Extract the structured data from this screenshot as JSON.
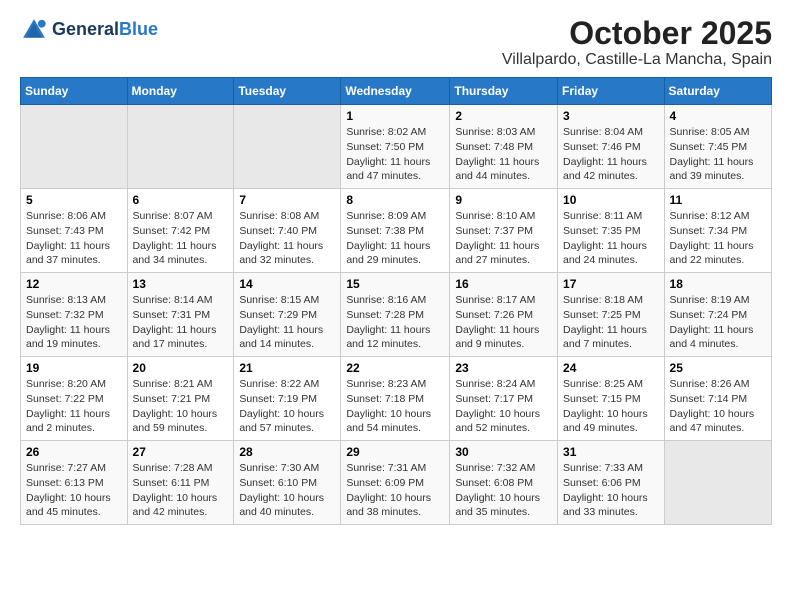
{
  "header": {
    "logo_general": "General",
    "logo_blue": "Blue",
    "month": "October 2025",
    "location": "Villalpardo, Castille-La Mancha, Spain"
  },
  "weekdays": [
    "Sunday",
    "Monday",
    "Tuesday",
    "Wednesday",
    "Thursday",
    "Friday",
    "Saturday"
  ],
  "weeks": [
    [
      {
        "day": "",
        "empty": true
      },
      {
        "day": "",
        "empty": true
      },
      {
        "day": "",
        "empty": true
      },
      {
        "day": "1",
        "sunrise": "8:02 AM",
        "sunset": "7:50 PM",
        "daylight": "11 hours and 47 minutes."
      },
      {
        "day": "2",
        "sunrise": "8:03 AM",
        "sunset": "7:48 PM",
        "daylight": "11 hours and 44 minutes."
      },
      {
        "day": "3",
        "sunrise": "8:04 AM",
        "sunset": "7:46 PM",
        "daylight": "11 hours and 42 minutes."
      },
      {
        "day": "4",
        "sunrise": "8:05 AM",
        "sunset": "7:45 PM",
        "daylight": "11 hours and 39 minutes."
      }
    ],
    [
      {
        "day": "5",
        "sunrise": "8:06 AM",
        "sunset": "7:43 PM",
        "daylight": "11 hours and 37 minutes."
      },
      {
        "day": "6",
        "sunrise": "8:07 AM",
        "sunset": "7:42 PM",
        "daylight": "11 hours and 34 minutes."
      },
      {
        "day": "7",
        "sunrise": "8:08 AM",
        "sunset": "7:40 PM",
        "daylight": "11 hours and 32 minutes."
      },
      {
        "day": "8",
        "sunrise": "8:09 AM",
        "sunset": "7:38 PM",
        "daylight": "11 hours and 29 minutes."
      },
      {
        "day": "9",
        "sunrise": "8:10 AM",
        "sunset": "7:37 PM",
        "daylight": "11 hours and 27 minutes."
      },
      {
        "day": "10",
        "sunrise": "8:11 AM",
        "sunset": "7:35 PM",
        "daylight": "11 hours and 24 minutes."
      },
      {
        "day": "11",
        "sunrise": "8:12 AM",
        "sunset": "7:34 PM",
        "daylight": "11 hours and 22 minutes."
      }
    ],
    [
      {
        "day": "12",
        "sunrise": "8:13 AM",
        "sunset": "7:32 PM",
        "daylight": "11 hours and 19 minutes."
      },
      {
        "day": "13",
        "sunrise": "8:14 AM",
        "sunset": "7:31 PM",
        "daylight": "11 hours and 17 minutes."
      },
      {
        "day": "14",
        "sunrise": "8:15 AM",
        "sunset": "7:29 PM",
        "daylight": "11 hours and 14 minutes."
      },
      {
        "day": "15",
        "sunrise": "8:16 AM",
        "sunset": "7:28 PM",
        "daylight": "11 hours and 12 minutes."
      },
      {
        "day": "16",
        "sunrise": "8:17 AM",
        "sunset": "7:26 PM",
        "daylight": "11 hours and 9 minutes."
      },
      {
        "day": "17",
        "sunrise": "8:18 AM",
        "sunset": "7:25 PM",
        "daylight": "11 hours and 7 minutes."
      },
      {
        "day": "18",
        "sunrise": "8:19 AM",
        "sunset": "7:24 PM",
        "daylight": "11 hours and 4 minutes."
      }
    ],
    [
      {
        "day": "19",
        "sunrise": "8:20 AM",
        "sunset": "7:22 PM",
        "daylight": "11 hours and 2 minutes."
      },
      {
        "day": "20",
        "sunrise": "8:21 AM",
        "sunset": "7:21 PM",
        "daylight": "10 hours and 59 minutes."
      },
      {
        "day": "21",
        "sunrise": "8:22 AM",
        "sunset": "7:19 PM",
        "daylight": "10 hours and 57 minutes."
      },
      {
        "day": "22",
        "sunrise": "8:23 AM",
        "sunset": "7:18 PM",
        "daylight": "10 hours and 54 minutes."
      },
      {
        "day": "23",
        "sunrise": "8:24 AM",
        "sunset": "7:17 PM",
        "daylight": "10 hours and 52 minutes."
      },
      {
        "day": "24",
        "sunrise": "8:25 AM",
        "sunset": "7:15 PM",
        "daylight": "10 hours and 49 minutes."
      },
      {
        "day": "25",
        "sunrise": "8:26 AM",
        "sunset": "7:14 PM",
        "daylight": "10 hours and 47 minutes."
      }
    ],
    [
      {
        "day": "26",
        "sunrise": "7:27 AM",
        "sunset": "6:13 PM",
        "daylight": "10 hours and 45 minutes."
      },
      {
        "day": "27",
        "sunrise": "7:28 AM",
        "sunset": "6:11 PM",
        "daylight": "10 hours and 42 minutes."
      },
      {
        "day": "28",
        "sunrise": "7:30 AM",
        "sunset": "6:10 PM",
        "daylight": "10 hours and 40 minutes."
      },
      {
        "day": "29",
        "sunrise": "7:31 AM",
        "sunset": "6:09 PM",
        "daylight": "10 hours and 38 minutes."
      },
      {
        "day": "30",
        "sunrise": "7:32 AM",
        "sunset": "6:08 PM",
        "daylight": "10 hours and 35 minutes."
      },
      {
        "day": "31",
        "sunrise": "7:33 AM",
        "sunset": "6:06 PM",
        "daylight": "10 hours and 33 minutes."
      },
      {
        "day": "",
        "empty": true
      }
    ]
  ]
}
